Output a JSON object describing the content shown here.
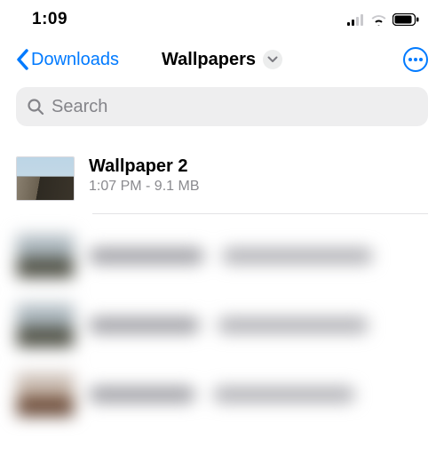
{
  "status": {
    "time": "1:09"
  },
  "nav": {
    "back_label": "Downloads",
    "title": "Wallpapers"
  },
  "search": {
    "placeholder": "Search"
  },
  "files": [
    {
      "name": "Wallpaper 2",
      "meta": "1:07 PM - 9.1 MB"
    }
  ]
}
